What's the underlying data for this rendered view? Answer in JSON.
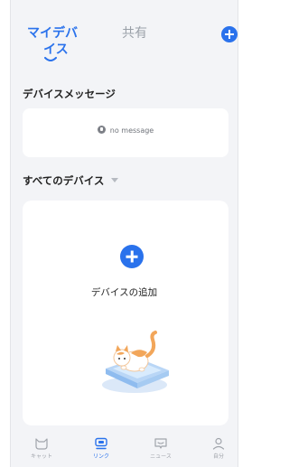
{
  "header": {
    "tabs": [
      {
        "label_line1": "マイデバ",
        "label_line2": "イス",
        "active": true
      },
      {
        "label": "共有",
        "active": false
      }
    ]
  },
  "messages": {
    "title": "デバイスメッセージ",
    "empty_text": "no message"
  },
  "devices": {
    "title": "すべてのデバイス",
    "add_label": "デバイスの追加"
  },
  "nav": [
    {
      "label": "キャット",
      "icon": "cat-icon",
      "active": false
    },
    {
      "label": "リンク",
      "icon": "device-link-icon",
      "active": true
    },
    {
      "label": "ニュース",
      "icon": "news-icon",
      "active": false
    },
    {
      "label": "自分",
      "icon": "user-icon",
      "active": false
    }
  ],
  "colors": {
    "accent": "#2a72ec",
    "background": "#f3f4f7",
    "card": "#ffffff",
    "inactive_text": "#9aa0a8"
  }
}
